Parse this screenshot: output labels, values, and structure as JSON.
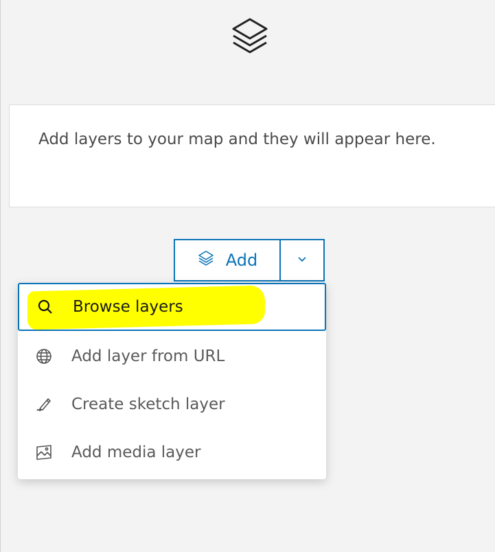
{
  "header": {
    "icon": "layers-icon"
  },
  "empty_state": {
    "message": "Add layers to your map and they will appear here."
  },
  "add_button": {
    "label": "Add",
    "icon": "layers-icon",
    "dropdown_icon": "chevron-down-icon"
  },
  "menu": {
    "items": [
      {
        "label": "Browse layers",
        "icon": "search-icon",
        "selected": true
      },
      {
        "label": "Add layer from URL",
        "icon": "globe-icon",
        "selected": false
      },
      {
        "label": "Create sketch layer",
        "icon": "pencil-icon",
        "selected": false
      },
      {
        "label": "Add media layer",
        "icon": "image-icon",
        "selected": false
      }
    ]
  },
  "colors": {
    "accent": "#0a73b8",
    "highlight": "#ffff00",
    "background": "#f3f3f3"
  }
}
